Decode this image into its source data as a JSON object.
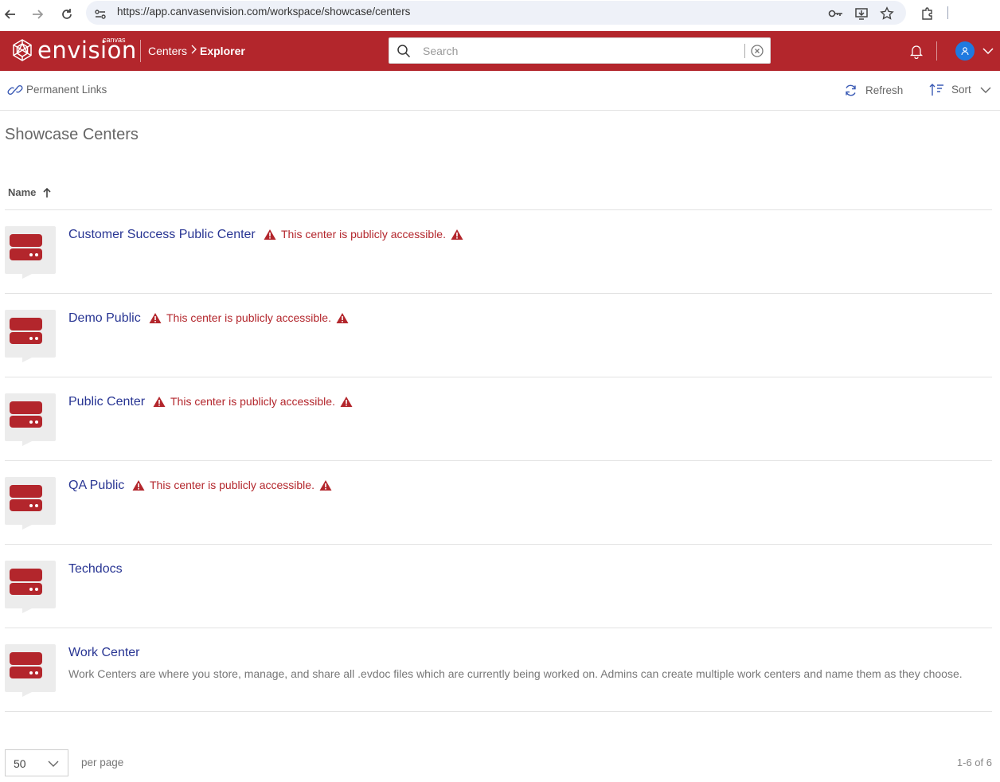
{
  "browser": {
    "url": "https://app.canvasenvision.com/workspace/showcase/centers"
  },
  "header": {
    "brand": "envision",
    "brand_sup": "canvas",
    "breadcrumb": [
      "Centers",
      "Explorer"
    ],
    "search_placeholder": "Search"
  },
  "toolbar": {
    "permanent_links": "Permanent Links",
    "refresh": "Refresh",
    "sort": "Sort"
  },
  "page": {
    "title": "Showcase Centers",
    "column_name": "Name"
  },
  "centers": [
    {
      "name": "Customer Success Public Center",
      "warning": "This center is publicly accessible.",
      "description": ""
    },
    {
      "name": "Demo Public",
      "warning": "This center is publicly accessible.",
      "description": ""
    },
    {
      "name": "Public Center",
      "warning": "This center is publicly accessible.",
      "description": ""
    },
    {
      "name": "QA Public",
      "warning": "This center is publicly accessible.",
      "description": ""
    },
    {
      "name": "Techdocs",
      "warning": "",
      "description": ""
    },
    {
      "name": "Work Center",
      "warning": "",
      "description": "Work Centers are where you store, manage, and share all .evdoc files which are currently being worked on. Admins can create multiple work centers and name them as they choose."
    }
  ],
  "pager": {
    "per_page_value": "50",
    "per_page_label": "per page",
    "range": "1-6 of 6"
  },
  "colors": {
    "brand_red": "#b3262c",
    "link_blue": "#283593",
    "avatar_blue": "#1f7ae0"
  },
  "icons": {
    "center": "center-tile-icon",
    "warning": "warning-triangle-icon"
  }
}
